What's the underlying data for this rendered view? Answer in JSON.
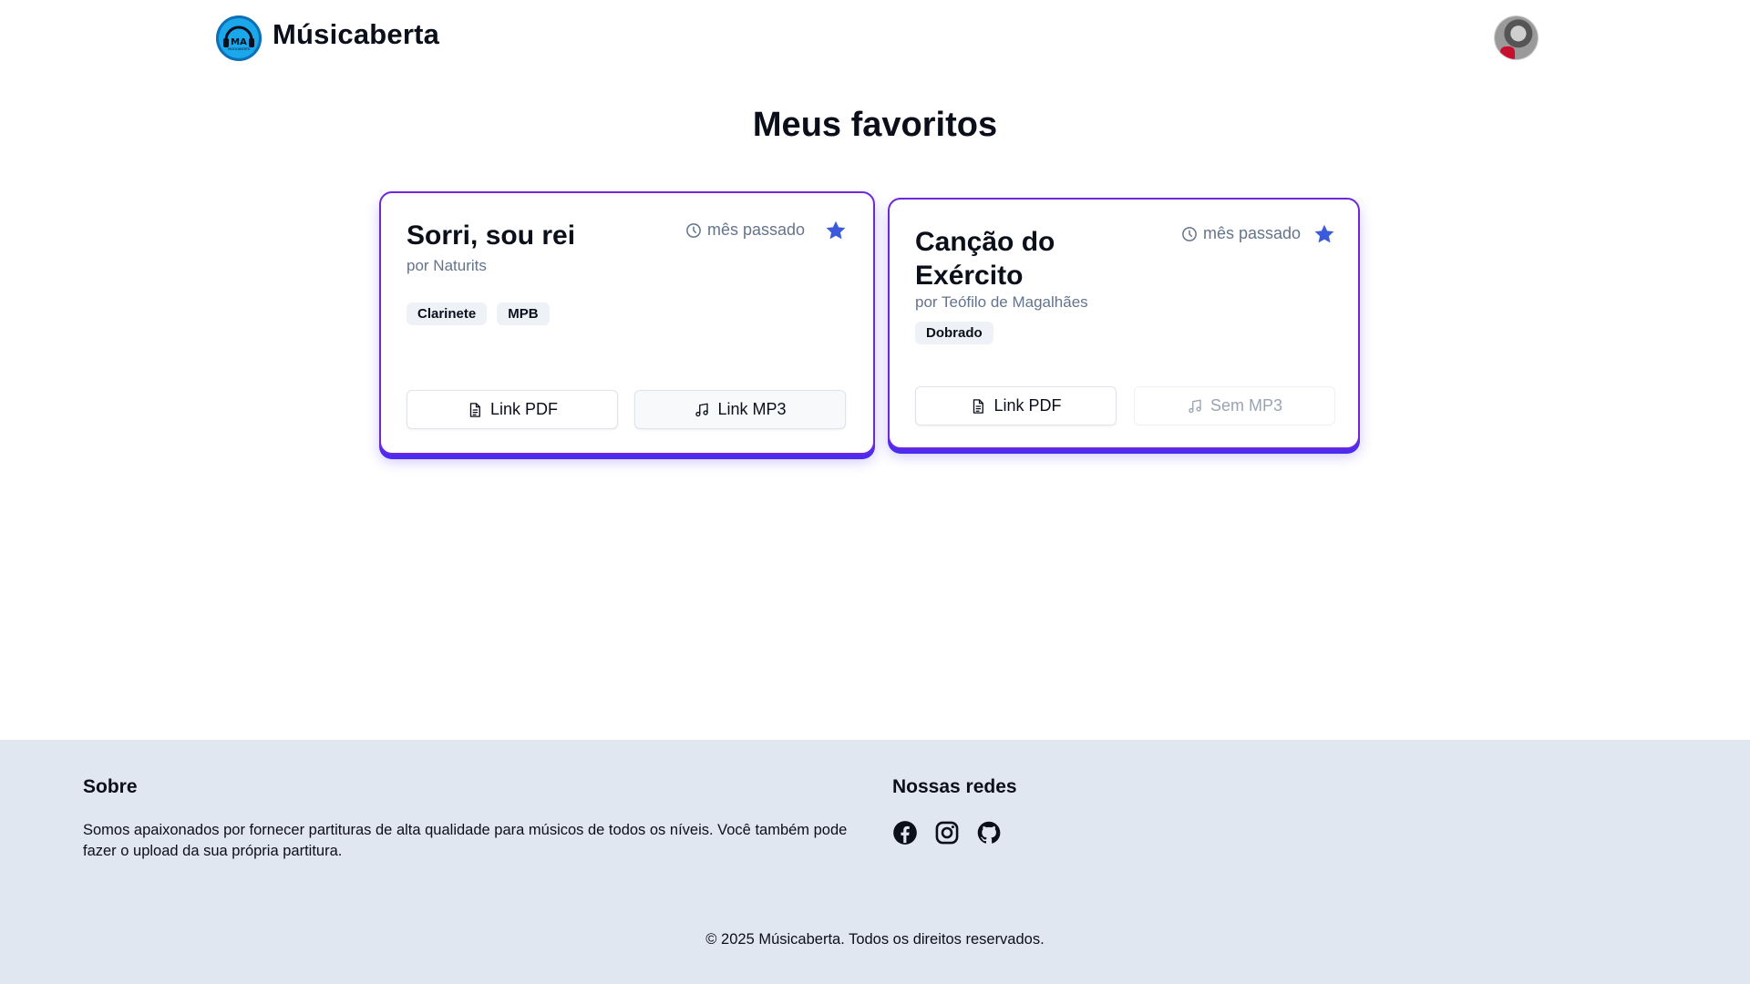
{
  "header": {
    "brand": "Músicaberta",
    "logo_text": "MA",
    "logo_subtext": "MÚSICABERTA",
    "logo_icon": "logo-icon",
    "avatar_icon": "user-avatar"
  },
  "page_title": "Meus favoritos",
  "colors": {
    "accent": "#4b2cf0",
    "card_border": "#6d28d9",
    "star": "#3b5bdb",
    "muted": "#64748b",
    "footer_bg": "#e1e7f1"
  },
  "cards": [
    {
      "title": "Sorri, sou rei",
      "author": "por Naturits",
      "time": "mês passado",
      "tags": [
        "Clarinete",
        "MPB"
      ],
      "favorite": true,
      "pdf_label": "Link PDF",
      "mp3_label": "Link MP3"
    },
    {
      "title": "Canção do Exército",
      "author": "por Teófilo de Magalhães",
      "time": "mês passado",
      "tags": [
        "Dobrado"
      ],
      "favorite": true,
      "pdf_label": "Link PDF",
      "mp3_label": "Sem MP3"
    }
  ],
  "footer": {
    "about_title": "Sobre",
    "about_text": "Somos apaixonados por fornecer partituras de alta qualidade para músicos de todos os níveis. Você também pode fazer o upload da sua própria partitura.",
    "social_title": "Nossas redes",
    "social_icons": [
      "facebook-icon",
      "instagram-icon",
      "github-icon"
    ],
    "copyright": "© 2025 Músicaberta. Todos os direitos reservados."
  }
}
